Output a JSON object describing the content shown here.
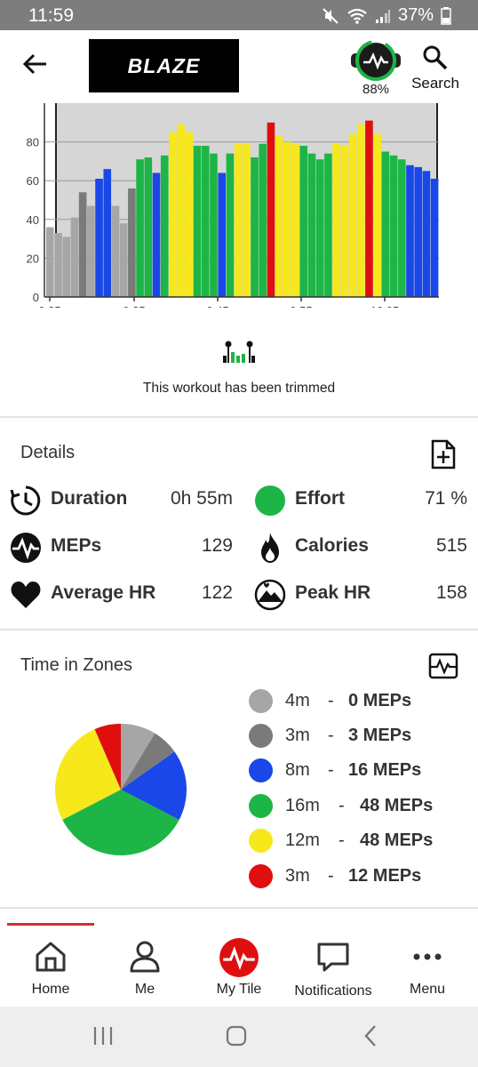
{
  "status_bar": {
    "time": "11:59",
    "battery": "37%"
  },
  "header": {
    "logo_text": "BLAZE",
    "tile_percent": "88%",
    "search_label": "Search"
  },
  "chart_data": {
    "type": "bar",
    "x_tick_labels": [
      "9:25",
      "9:35",
      "9:45",
      "9:55",
      "10:05"
    ],
    "y_tick_labels": [
      "0",
      "20",
      "40",
      "60",
      "80"
    ],
    "ylim": [
      0,
      100
    ],
    "xlabel": "",
    "ylabel": "",
    "grid": true,
    "zone_colors": {
      "gray_light": "#a6a6a6",
      "gray": "#7a7a7a",
      "blue": "#1a47e8",
      "green": "#1db546",
      "yellow": "#f7e81c",
      "red": "#e00f0f"
    },
    "values": [
      36,
      33,
      31,
      41,
      54,
      47,
      61,
      66,
      47,
      38,
      56,
      71,
      72,
      64,
      73,
      85,
      89,
      85,
      78,
      78,
      74,
      64,
      74,
      79,
      79,
      72,
      79,
      90,
      83,
      80,
      79,
      78,
      74,
      71,
      74,
      79,
      78,
      84,
      89,
      91,
      84,
      75,
      73,
      71,
      68,
      67,
      65,
      61
    ],
    "zones": [
      "gray_light",
      "gray_light",
      "gray_light",
      "gray_light",
      "gray",
      "gray_light",
      "blue",
      "blue",
      "gray_light",
      "gray_light",
      "gray",
      "green",
      "green",
      "blue",
      "green",
      "yellow",
      "yellow",
      "yellow",
      "green",
      "green",
      "green",
      "blue",
      "green",
      "yellow",
      "yellow",
      "green",
      "green",
      "red",
      "yellow",
      "yellow",
      "yellow",
      "green",
      "green",
      "green",
      "green",
      "yellow",
      "yellow",
      "yellow",
      "yellow",
      "red",
      "yellow",
      "green",
      "green",
      "green",
      "blue",
      "blue",
      "blue",
      "blue"
    ]
  },
  "trim": {
    "message": "This workout has been trimmed"
  },
  "details": {
    "title": "Details",
    "duration_label": "Duration",
    "duration_value": "0h 55m",
    "effort_label": "Effort",
    "effort_value": "71 %",
    "meps_label": "MEPs",
    "meps_value": "129",
    "calories_label": "Calories",
    "calories_value": "515",
    "avg_hr_label": "Average HR",
    "avg_hr_value": "122",
    "peak_hr_label": "Peak HR",
    "peak_hr_value": "158"
  },
  "zones": {
    "title": "Time in Zones",
    "pie": [
      {
        "color": "#a6a6a6",
        "minutes": 4
      },
      {
        "color": "#7a7a7a",
        "minutes": 3
      },
      {
        "color": "#1a47e8",
        "minutes": 8
      },
      {
        "color": "#1db546",
        "minutes": 16
      },
      {
        "color": "#f7e81c",
        "minutes": 12
      },
      {
        "color": "#e00f0f",
        "minutes": 3
      }
    ],
    "legend": [
      {
        "time": "4m",
        "dash": "-",
        "meps": "0 MEPs",
        "color": "#a6a6a6"
      },
      {
        "time": "3m",
        "dash": "-",
        "meps": "3 MEPs",
        "color": "#7a7a7a"
      },
      {
        "time": "8m",
        "dash": "-",
        "meps": "16 MEPs",
        "color": "#1a47e8"
      },
      {
        "time": "16m",
        "dash": "-",
        "meps": "48 MEPs",
        "color": "#1db546"
      },
      {
        "time": "12m",
        "dash": "-",
        "meps": "48 MEPs",
        "color": "#f7e81c"
      },
      {
        "time": "3m",
        "dash": "-",
        "meps": "12 MEPs",
        "color": "#e00f0f"
      }
    ]
  },
  "nav": {
    "home": "Home",
    "me": "Me",
    "my_tile": "My Tile",
    "notifications": "Notifications",
    "menu": "Menu"
  },
  "colors": {
    "accent": "#d32f2f",
    "effort_green": "#1db546"
  }
}
